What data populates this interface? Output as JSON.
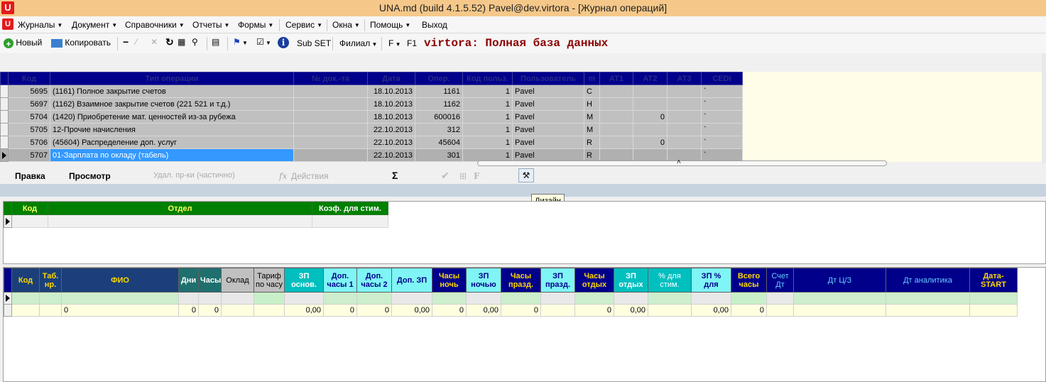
{
  "window": {
    "title": "UNA.md (build 4.1.5.52) Pavel@dev.virtora - [Журнал операций]",
    "logo": "U"
  },
  "menu": [
    {
      "label": "Журналы"
    },
    {
      "label": "Документ"
    },
    {
      "label": "Справочники"
    },
    {
      "label": "Отчеты"
    },
    {
      "label": "Формы"
    },
    {
      "label": "Сервис"
    },
    {
      "label": "Окна"
    },
    {
      "label": "Помощь"
    },
    {
      "label": "Выход"
    }
  ],
  "toolbar": {
    "new_label": "Новый",
    "copy_label": "Копировать",
    "subset_label": "Sub SET",
    "branch_label": "Филиал",
    "f_label": "F",
    "f1_label": "F1",
    "db_name": "virtora: Полная база данных"
  },
  "ops_grid": {
    "columns": [
      "Код",
      "Тип операции",
      "№ док.-та",
      "Дата",
      "Опер.",
      "Код польз.",
      "Пользователь",
      "m",
      "AT1",
      "AT2",
      "AT3",
      "CEDI"
    ],
    "rows": [
      {
        "code": "5695",
        "type": "(1161) Полное закрытие счетов",
        "doc": "",
        "date": "18.10.2013",
        "oper": "1161",
        "ucode": "1",
        "user": "Pavel",
        "m": "C",
        "at1": "",
        "at2": "",
        "at3": "",
        "cedi": "`"
      },
      {
        "code": "5697",
        "type": "(1162) Взаимное закрытие счетов (221 521 и т.д.)",
        "doc": "",
        "date": "18.10.2013",
        "oper": "1162",
        "ucode": "1",
        "user": "Pavel",
        "m": "H",
        "at1": "",
        "at2": "",
        "at3": "",
        "cedi": "`"
      },
      {
        "code": "5704",
        "type": "(1420) Приобретение мат. ценностей из-за рубежа",
        "doc": "",
        "date": "18.10.2013",
        "oper": "600016",
        "ucode": "1",
        "user": "Pavel",
        "m": "M",
        "at1": "",
        "at2": "0",
        "at3": "",
        "cedi": "`"
      },
      {
        "code": "5705",
        "type": "12-Прочие начисления",
        "doc": "",
        "date": "22.10.2013",
        "oper": "312",
        "ucode": "1",
        "user": "Pavel",
        "m": "M",
        "at1": "",
        "at2": "",
        "at3": "",
        "cedi": "`"
      },
      {
        "code": "5706",
        "type": "(45604) Распределение доп. услуг",
        "doc": "",
        "date": "22.10.2013",
        "oper": "45604",
        "ucode": "1",
        "user": "Pavel",
        "m": "R",
        "at1": "",
        "at2": "0",
        "at3": "",
        "cedi": "`"
      },
      {
        "code": "5707",
        "type": "01-Зарплата по окладу (табель)",
        "doc": "",
        "date": "22.10.2013",
        "oper": "301",
        "ucode": "1",
        "user": "Pavel",
        "m": "R",
        "at1": "",
        "at2": "",
        "at3": "",
        "cedi": "`"
      }
    ]
  },
  "actions": {
    "edit": "Правка",
    "view": "Просмотр",
    "delete_partial": "Удал. пр-ки  (частично)",
    "fx": "fx",
    "actions": "Действия",
    "sigma": "Σ",
    "check": "✔",
    "f_small": "F",
    "tooltip": "Дизайн"
  },
  "dept_grid": {
    "columns": [
      "Код",
      "Отдел",
      "Коэф. для стим."
    ]
  },
  "sal_grid": {
    "columns": [
      "Код",
      "Таб. нр.",
      "ФИО",
      "Дни",
      "Часы",
      "Оклад",
      "Тариф по часу",
      "ЗП основ.",
      "Доп. часы 1",
      "Доп. часы 2",
      "Доп. ЗП",
      "Часы ночь",
      "ЗП ночью",
      "Часы празд.",
      "ЗП празд.",
      "Часы отдых",
      "ЗП отдых",
      "% для стим.",
      "ЗП % для",
      "Всего часы",
      "Счет Дт",
      "Дт Ц/З",
      "Дт аналитика",
      "Дата-START"
    ],
    "row2": [
      "",
      "",
      "0",
      "0",
      "0",
      "",
      "",
      "0,00",
      "0",
      "0",
      "0,00",
      "0",
      "0,00",
      "0",
      "",
      "0",
      "0,00",
      "",
      "0,00",
      "0",
      "",
      "",
      "",
      ""
    ]
  },
  "colors": {
    "titlebar": "#f5c88a",
    "grid_header": "#00008b",
    "selection": "#3399ff",
    "db_name": "#8b0000",
    "dept_header": "#008000"
  }
}
